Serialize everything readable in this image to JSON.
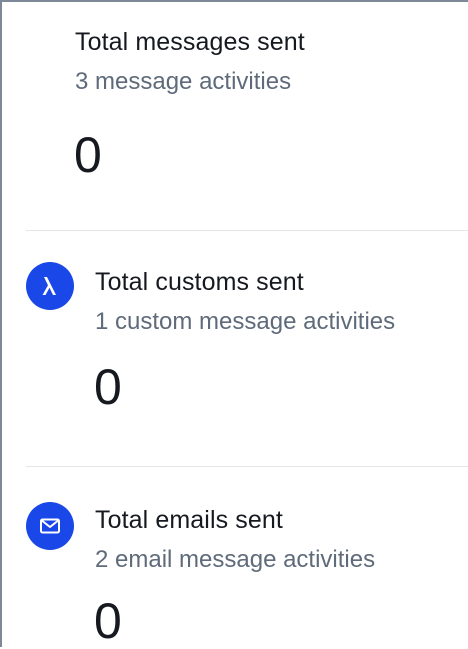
{
  "colors": {
    "badge_background": "#1a48e8",
    "title_text": "#16191f",
    "subtitle_text": "#5f6b7a",
    "divider": "#e3e6e9",
    "panel_border": "#7d8998"
  },
  "metrics": {
    "messages": {
      "title": "Total messages sent",
      "subtitle": "3 message activities",
      "value": "0"
    },
    "customs": {
      "icon": "lambda-icon",
      "title": "Total customs sent",
      "subtitle": "1 custom message activities",
      "value": "0"
    },
    "emails": {
      "icon": "envelope-icon",
      "title": "Total emails sent",
      "subtitle": "2 email message activities",
      "value": "0"
    }
  }
}
